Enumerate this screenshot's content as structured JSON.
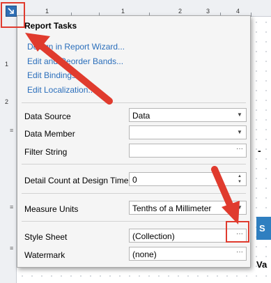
{
  "ruler": {
    "top_numbers": [
      "1",
      "1",
      "2",
      "3",
      "4"
    ],
    "left_numbers": [
      "1",
      "2"
    ]
  },
  "background": {
    "dash": "-",
    "s_letter": "S",
    "va_text": "Va"
  },
  "popup": {
    "title": "Report Tasks",
    "links": [
      "Design in Report Wizard...",
      "Edit and Reorder Bands...",
      "Edit Bindings...",
      "Edit Localization..."
    ],
    "data_source": {
      "label": "Data Source",
      "value": "Data"
    },
    "data_member": {
      "label": "Data Member",
      "value": ""
    },
    "filter_string": {
      "label": "Filter String",
      "value": ""
    },
    "detail_count": {
      "label": "Detail Count at Design Time",
      "value": "0"
    },
    "measure_units": {
      "label": "Measure Units",
      "value": "Tenths of a Millimeter"
    },
    "style_sheet": {
      "label": "Style Sheet",
      "value": "(Collection)"
    },
    "watermark": {
      "label": "Watermark",
      "value": "(none)"
    }
  },
  "icons": {
    "smart_tag": "smart-tag-arrow-icon",
    "dropdown": "chevron-down-icon",
    "ellipsis": "ellipsis-icon",
    "spin": "spin-updown-icon",
    "band_collapse": "band-collapse-icon"
  },
  "colors": {
    "annotation": "#e03b2e",
    "link": "#2a6ebb",
    "accent": "#2f7fc0"
  }
}
